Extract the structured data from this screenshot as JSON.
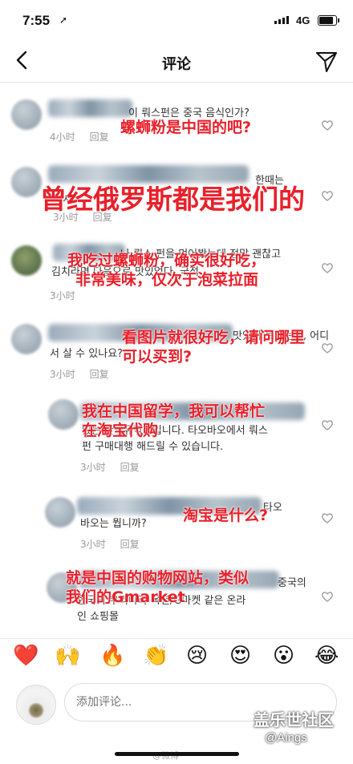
{
  "status_bar": {
    "time": "7:55",
    "location_glyph": "➚",
    "network": "4G"
  },
  "nav": {
    "title": "评论"
  },
  "comments": [
    {
      "korean_line1": "이 뤄스펀은 중국 음식인가?",
      "korean_line2": "",
      "time": "4小时",
      "reply": "回复",
      "translation": "螺蛳粉是中国的吧?"
    },
    {
      "korean_line1": "한때는",
      "korean_line2": "러시",
      "time": "3小时",
      "reply": "回复",
      "translation": "曾经俄罗斯都是我们的"
    },
    {
      "korean_line1": "나 뤄스 펀을 먹어봤는데 정말 괜찮고",
      "korean_line2": "김치라면 다음으로 맛있었다. 국적",
      "time": "3小时",
      "reply": "回复",
      "translation_lines": [
        "我吃过螺蛳粉，确实很好吃，",
        "非常美味，仅次于泡菜拉面"
      ]
    },
    {
      "korean_line1": "맛있어 보이는데, 어디",
      "korean_line2": "서 살 수 있나요?",
      "time": "3小时",
      "reply": "回复",
      "translation_lines": [
        "看图片就很好吃，请问哪里",
        "可以买到?"
      ]
    },
    {
      "korean_line1": "있는 한국유학생입니다. 타오바오에서 뤄스",
      "korean_line2": "펀 구매대행 해드릴 수 있습니다.",
      "time": "3小时",
      "reply": "回复",
      "translation_lines": [
        "我在中国留学，我可以帮忙",
        "在淘宝代购"
      ]
    },
    {
      "korean_line1": "타오",
      "korean_line2": "바오는 뭡니까?",
      "time": "3小时",
      "reply": "回复",
      "translation": "淘宝是什么?"
    },
    {
      "korean_line1": "중국의",
      "korean_line2": "한국의 우리나라 옥션/G마켓 같은 온라",
      "korean_line3": "인 쇼핑몰",
      "time": "",
      "reply": "",
      "translation_lines": [
        "就是中国的购物网站，类似",
        "我们的Gmarket"
      ]
    }
  ],
  "emoji_bar": [
    "❤️",
    "🙌",
    "🔥",
    "👏",
    "😢",
    "😍",
    "😮",
    "😂"
  ],
  "input": {
    "placeholder": "添加评论..."
  },
  "watermark": {
    "line1": "盖乐世社区",
    "line2": "@Aings",
    "line3": "@微博"
  },
  "colors": {
    "accent_red": "#e8202a",
    "meta_gray": "#999999"
  }
}
